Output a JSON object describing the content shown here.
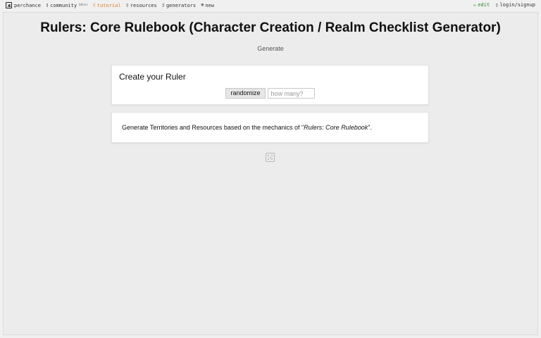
{
  "nav": {
    "brand": "perchance",
    "community": "community",
    "community_tag": "(die)",
    "tutorial": "tutorial",
    "resources": "resources",
    "generators": "generators",
    "new": "new",
    "edit": "edit",
    "login": "login/signup",
    "accent_tutorial": "#d9822b",
    "accent_edit": "#2a8a2a"
  },
  "page": {
    "title": "Rulers: Core Rulebook (Character Creation / Realm Checklist Generator)",
    "generate_label": "Generate"
  },
  "ruler_card": {
    "heading": "Create your Ruler",
    "randomize_label": "randomize",
    "count_placeholder": "how many?",
    "count_value": ""
  },
  "info_card": {
    "text_before": "Generate Territories and Resources based on the mechanics of \"",
    "book_title": "Rulers: Core Rulebook",
    "text_after": "\"."
  }
}
